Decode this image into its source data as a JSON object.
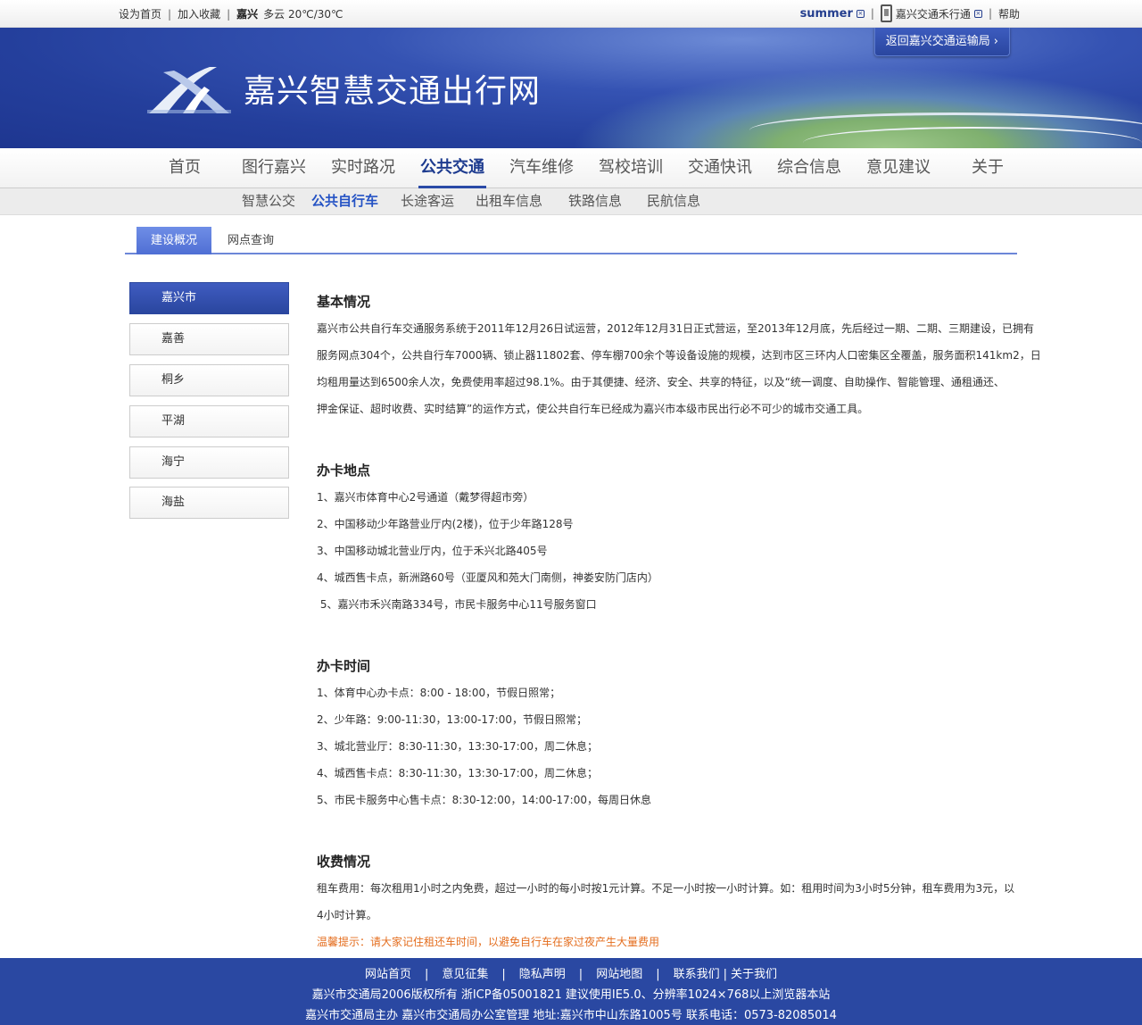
{
  "topbar": {
    "links": [
      "设为首页",
      "加入收藏"
    ],
    "city": "嘉兴",
    "weather": "多云 20℃/30℃",
    "user": "summer",
    "app": "嘉兴交通禾行通",
    "help": "帮助"
  },
  "banner": {
    "site_title": "嘉兴智慧交通出行网",
    "back_button": "返回嘉兴交通运输局"
  },
  "main_nav": [
    {
      "label": "首页",
      "active": false
    },
    {
      "label": "图行嘉兴",
      "active": false
    },
    {
      "label": "实时路况",
      "active": false
    },
    {
      "label": "公共交通",
      "active": true
    },
    {
      "label": "汽车维修",
      "active": false
    },
    {
      "label": "驾校培训",
      "active": false
    },
    {
      "label": "交通快讯",
      "active": false
    },
    {
      "label": "综合信息",
      "active": false
    },
    {
      "label": "意见建议",
      "active": false
    },
    {
      "label": "关于",
      "active": false
    }
  ],
  "sub_nav": [
    {
      "label": "智慧公交",
      "active": false
    },
    {
      "label": "公共自行车",
      "active": true
    },
    {
      "label": "长途客运",
      "active": false
    },
    {
      "label": "出租车信息",
      "active": false
    },
    {
      "label": "铁路信息",
      "active": false
    },
    {
      "label": "民航信息",
      "active": false
    }
  ],
  "tabs": {
    "active": "建设概况",
    "inactive": "网点查询"
  },
  "sidebar": [
    "嘉兴市",
    "嘉善",
    "桐乡",
    "平湖",
    "海宁",
    "海盐"
  ],
  "article": {
    "s1_title": "基本情况",
    "s1_lines": [
      "嘉兴市公共自行车交通服务系统于2011年12月26日试运营，2012年12月31日正式营运，至2013年12月底，先后经过一期、二期、三期建设，已拥有",
      "服务网点304个，公共自行车7000辆、锁止器11802套、停车棚700余个等设备设施的规模，达到市区三环内人口密集区全覆盖，服务面积141km2，日",
      "均租用量达到6500余人次，免费使用率超过98.1%。由于其便捷、经济、安全、共享的特征，以及“统一调度、自助操作、智能管理、通租通还、",
      "押金保证、超时收费、实时结算”的运作方式，使公共自行车已经成为嘉兴市本级市民出行必不可少的城市交通工具。"
    ],
    "s2_title": "办卡地点",
    "s2_lines": [
      "1、嘉兴市体育中心2号通道（戴梦得超市旁）",
      "2、中国移动少年路营业厅内(2楼)，位于少年路128号",
      "3、中国移动城北营业厅内，位于禾兴北路405号",
      "4、城西售卡点，新洲路60号（亚厦风和苑大门南侧，神娄安防门店内）",
      " 5、嘉兴市禾兴南路334号，市民卡服务中心11号服务窗口"
    ],
    "s3_title": "办卡时间",
    "s3_lines": [
      "1、体育中心办卡点：8:00 - 18:00，节假日照常；",
      "2、少年路：9:00-11:30，13:00-17:00，节假日照常；",
      "3、城北营业厅：8:30-11:30，13:30-17:00，周二休息；",
      "4、城西售卡点：8:30-11:30，13:30-17:00，周二休息；",
      "5、市民卡服务中心售卡点：8:30-12:00，14:00-17:00，每周日休息"
    ],
    "s4_title": "收费情况",
    "s4_lines": [
      "租车费用：每次租用1小时之内免费，超过一小时的每小时按1元计算。不足一小时按一小时计算。如：租用时间为3小时5分钟，租车费用为3元，以",
      "4小时计算。"
    ],
    "warning": "温馨提示：请大家记住租还车时间，以避免自行车在家过夜产生大量费用"
  },
  "footer": {
    "links": [
      "网站首页",
      "意见征集",
      "隐私声明",
      "网站地图",
      "联系我们",
      "关于我们"
    ],
    "copyright": "嘉兴市交通局2006版权所有 浙ICP备05001821 建议使用IE5.0、分辨率1024×768以上浏览器本站",
    "address": "嘉兴市交通局主办 嘉兴市交通局办公室管理  地址:嘉兴市中山东路1005号 联系电话：0573-82085014"
  },
  "colors": {
    "brand_blue": "#2a48a2",
    "active_link": "#2452c4",
    "warning": "#e46e1f"
  }
}
